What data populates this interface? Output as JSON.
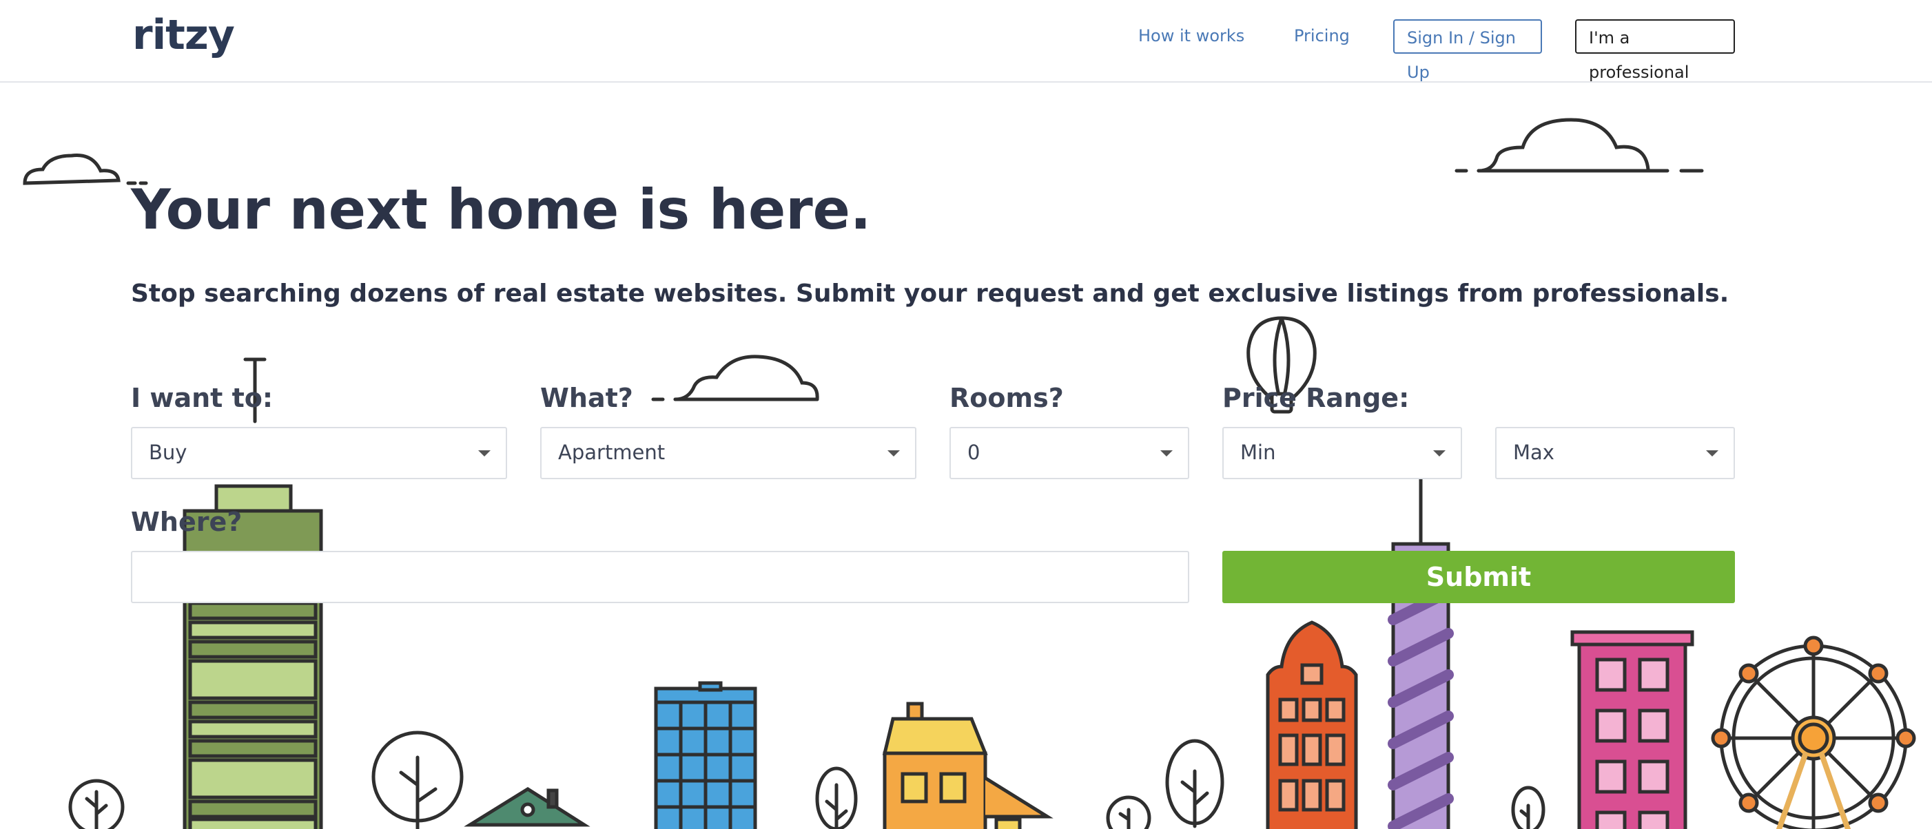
{
  "header": {
    "logo": "ritzy",
    "nav": {
      "how_it_works": "How it works",
      "pricing": "Pricing",
      "sign_in": "Sign In / Sign Up",
      "professional": "I'm a professional"
    }
  },
  "hero": {
    "headline": "Your next home is here.",
    "subhead": "Stop searching dozens of real estate websites. Submit your request and get exclusive listings from professionals."
  },
  "form": {
    "want_label": "I want to:",
    "want_value": "Buy",
    "what_label": "What?",
    "what_value": "Apartment",
    "rooms_label": "Rooms?",
    "rooms_value": "0",
    "price_label": "Price Range:",
    "price_min": "Min",
    "price_max": "Max",
    "where_label": "Where?",
    "where_value": "",
    "submit_label": "Submit"
  },
  "colors": {
    "accent_green": "#72b535",
    "link_blue": "#4a79b6",
    "text_dark": "#2c3347"
  }
}
